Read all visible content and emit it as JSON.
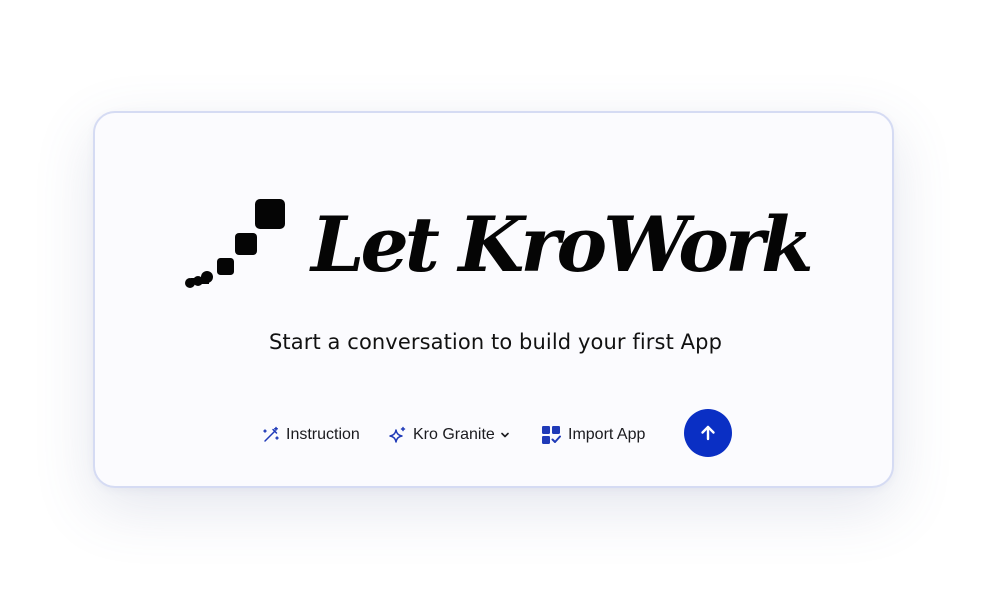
{
  "brand": {
    "title": "Let KroWork",
    "logo_icon": "stepped-squares-logo-icon"
  },
  "subtitle": "Start a conversation to build your first App",
  "toolbar": {
    "instruction": {
      "label": "Instruction",
      "icon": "wand-icon"
    },
    "model": {
      "label": "Kro Granite",
      "icon": "sparkle-icon",
      "dropdown_icon": "chevron-down-icon"
    },
    "import": {
      "label": "Import App",
      "icon": "import-grid-icon"
    },
    "send": {
      "icon": "arrow-up-icon"
    }
  },
  "colors": {
    "accent": "#0a2fc4",
    "icon_blue": "#1f3ab8",
    "card_border": "#d5dbf3",
    "card_background": "#fbfbfe",
    "text": "#111111"
  }
}
